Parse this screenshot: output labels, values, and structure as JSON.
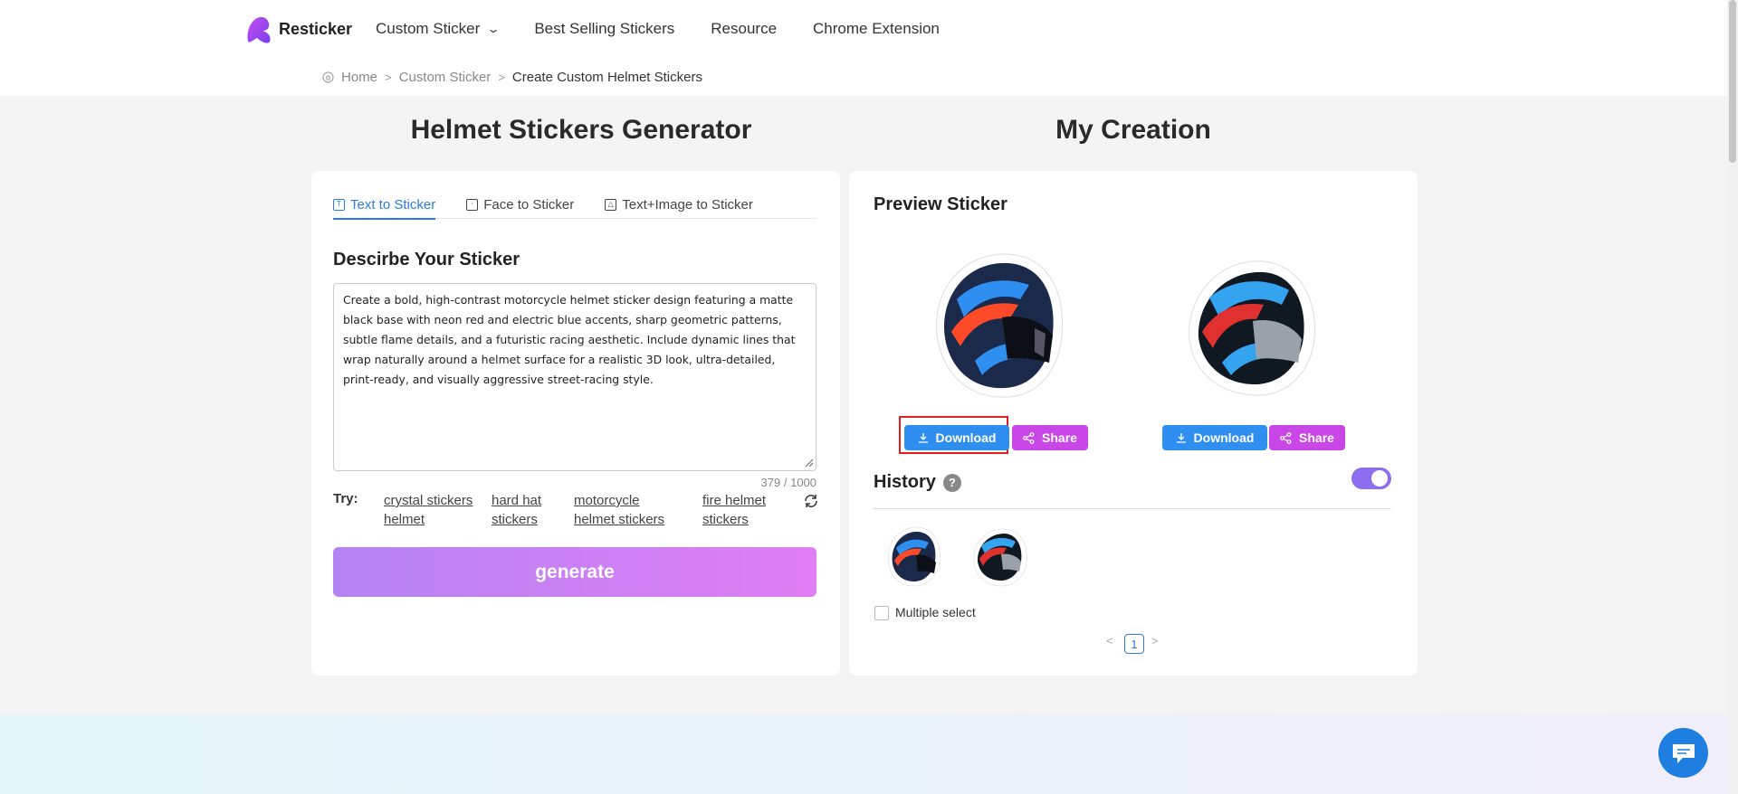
{
  "header": {
    "logo_text": "Resticker",
    "nav": [
      {
        "label": "Custom Sticker",
        "has_dropdown": true
      },
      {
        "label": "Best Selling Stickers"
      },
      {
        "label": "Resource"
      },
      {
        "label": "Chrome Extension"
      }
    ]
  },
  "breadcrumb": {
    "home": "Home",
    "parent": "Custom Sticker",
    "current": "Create Custom Helmet Stickers"
  },
  "generator": {
    "title": "Helmet Stickers Generator",
    "tabs": [
      {
        "label": "Text to Sticker",
        "icon": "text-icon",
        "active": true
      },
      {
        "label": "Face to Sticker",
        "icon": "face-icon"
      },
      {
        "label": "Text+Image to Sticker",
        "icon": "image-icon"
      }
    ],
    "describe_title": "Descirbe Your Sticker",
    "prompt_text": "Create a bold, high-contrast motorcycle helmet sticker design featuring a matte black base with neon red and electric blue accents, sharp geometric patterns, subtle flame details, and a futuristic racing aesthetic. Include dynamic lines that wrap naturally around a helmet surface for a realistic 3D look, ultra-detailed, print-ready, and visually aggressive street-racing style.",
    "counter": "379 / 1000",
    "try_label": "Try:",
    "suggestions": [
      "crystal stickers helmet",
      "hard hat stickers",
      "motorcycle helmet stickers",
      "fire helmet stickers"
    ],
    "generate_label": "generate",
    "gradient": [
      "#b483f2",
      "#e07ef5"
    ]
  },
  "creation": {
    "title": "My Creation",
    "preview_title": "Preview Sticker",
    "previews": [
      {
        "download_label": "Download",
        "share_label": "Share"
      },
      {
        "download_label": "Download",
        "share_label": "Share"
      }
    ],
    "history_title": "History",
    "help_icon": "?",
    "toggle_on": true,
    "multiple_select_label": "Multiple select",
    "page": "1"
  },
  "colors": {
    "accent": "#2a7be4",
    "download": "#2e8ff0",
    "share": "#c847e6",
    "toggle": "#8e6ef0",
    "highlight": "#e02020"
  }
}
